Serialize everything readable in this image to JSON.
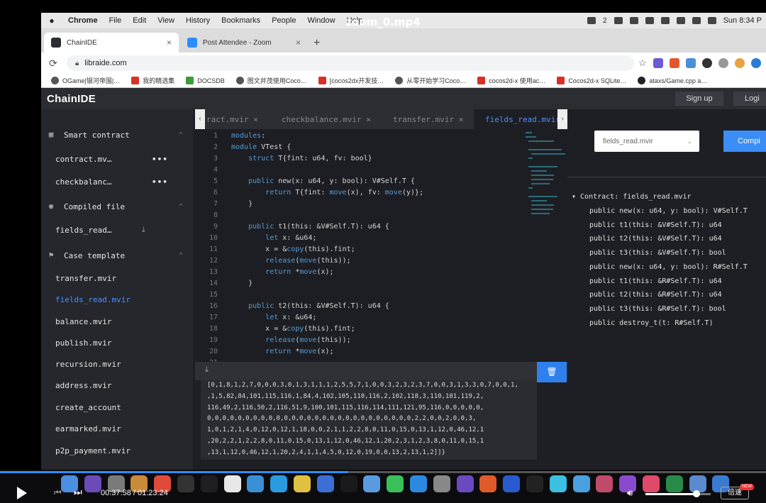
{
  "video": {
    "title": "zoom_0.mp4",
    "time": "00:37:58 / 01:23:24",
    "progress": 0.455,
    "volume": 0.78,
    "speed_label": "倍速",
    "new_badge": "NEW"
  },
  "menubar": {
    "items": [
      "Chrome",
      "File",
      "Edit",
      "View",
      "History",
      "Bookmarks",
      "People",
      "Window",
      "Help"
    ],
    "wechat_count": "2",
    "clock": "Sun 8:34 P"
  },
  "browser": {
    "tabs": [
      {
        "label": "ChainIDE",
        "close": "×"
      },
      {
        "label": "Post Attendee - Zoom",
        "close": "×"
      }
    ],
    "new_tab": "+",
    "url": "libraide.com",
    "bookmarks": [
      "OGame|银河帝国|…",
      "我的精选集",
      "DOCSDB",
      "图文并茂使用Coco…",
      "[cocos2dx开发技…",
      "从零开始学习Coco…",
      "cocos2d-x 使用ac…",
      "Cocos2d-x SQLite…",
      "ataxs/Game.cpp a…"
    ]
  },
  "ide": {
    "logo": "ChainIDE",
    "signup": "Sign up",
    "login": "Logi",
    "sidebar": {
      "smart_contract": {
        "title": "Smart contract",
        "items": [
          "contract.mv…",
          "checkbalanc…"
        ],
        "more": "•••"
      },
      "compiled_file": {
        "title": "Compiled file",
        "items": [
          "fields_read…"
        ]
      },
      "case_template": {
        "title": "Case template",
        "items": [
          "transfer.mvir",
          "fields_read.mvir",
          "balance.mvir",
          "publish.mvir",
          "recursion.mvir",
          "address.mvir",
          "create_account",
          "earmarked.mvir",
          "p2p_payment.mvir"
        ]
      }
    },
    "file_tabs": [
      "ract.mvir ×",
      "checkbalance.mvir ×",
      "transfer.mvir ×",
      "fields_read.mvir"
    ],
    "code_lines": [
      {
        "n": "1",
        "text": "modules:"
      },
      {
        "n": "2",
        "text": "module VTest {"
      },
      {
        "n": "3",
        "text": "    struct T{fint: u64, fv: bool}"
      },
      {
        "n": "4",
        "text": ""
      },
      {
        "n": "5",
        "text": "    public new(x: u64, y: bool): V#Self.T {"
      },
      {
        "n": "6",
        "text": "        return T{fint: move(x), fv: move(y)};"
      },
      {
        "n": "7",
        "text": "    }"
      },
      {
        "n": "8",
        "text": ""
      },
      {
        "n": "9",
        "text": "    public t1(this: &V#Self.T): u64 {"
      },
      {
        "n": "10",
        "text": "        let x: &u64;"
      },
      {
        "n": "11",
        "text": "        x = &copy(this).fint;"
      },
      {
        "n": "12",
        "text": "        release(move(this));"
      },
      {
        "n": "13",
        "text": "        return *move(x);"
      },
      {
        "n": "14",
        "text": "    }"
      },
      {
        "n": "15",
        "text": ""
      },
      {
        "n": "16",
        "text": "    public t2(this: &V#Self.T): u64 {"
      },
      {
        "n": "17",
        "text": "        let x: &u64;"
      },
      {
        "n": "18",
        "text": "        x = &copy(this).fint;"
      },
      {
        "n": "19",
        "text": "        release(move(this));"
      },
      {
        "n": "20",
        "text": "        return *move(x);"
      },
      {
        "n": "21",
        "text": ""
      }
    ],
    "output_lines": [
      "[0,1,8,1,2,7,0,0,0,3,0,1,3,1,1,1,2,5,5,7,1,0,0,3,2,3,2,3,7,0,0,3,1,3,3,0,7,0,0,1,",
      ",1,5,82,84,101,115,116,1,84,4,102,105,110,116,2,102,118,3,110,101,119,2,",
      "116,49,2,116,50,2,116,51,9,100,101,115,116,114,111,121,95,116,0,0,0,0,0,",
      "0,0,0,0,0,0,0,0,0,0,0,0,0,0,0,0,0,0,0,0,0,0,0,0,0,0,0,2,2,0,0,2,0,0,3,",
      "1,0,1,2,1,4,0,12,0,12,1,18,0,0,2,1,1,2,2,8,0,11,0,15,0,13,1,12,0,46,12,1",
      ",20,2,2,1,2,2,8,0,11,0,15,0,13,1,12,0,46,12,1,20,2,3,1,2,3,8,0,11,0,15,1",
      ",13,1,12,0,46,12,1,20,2,4,1,1,4,5,0,12,0,19,0,0,13,2,13,1,2]]}"
    ],
    "right_panel": {
      "select_value": "fields_read.mvir",
      "compile": "Compi",
      "contract_title": "▾ Contract: fields_read.mvir",
      "functions": [
        "public new(x: u64, y: bool): V#Self.T",
        "public t1(this: &V#Self.T): u64",
        "public t2(this: &V#Self.T): u64",
        "public t3(this: &V#Self.T): bool",
        "public new(x: u64, y: bool): R#Self.T",
        "public t1(this: &R#Self.T): u64",
        "public t2(this: &R#Self.T): u64",
        "public t3(this: &R#Self.T): bool",
        "public destroy_t(t: R#Self.T)"
      ]
    }
  },
  "colors": {
    "accent": "#2f80ed",
    "active_file": "#4d90ff",
    "progress": "#2f8cff"
  }
}
